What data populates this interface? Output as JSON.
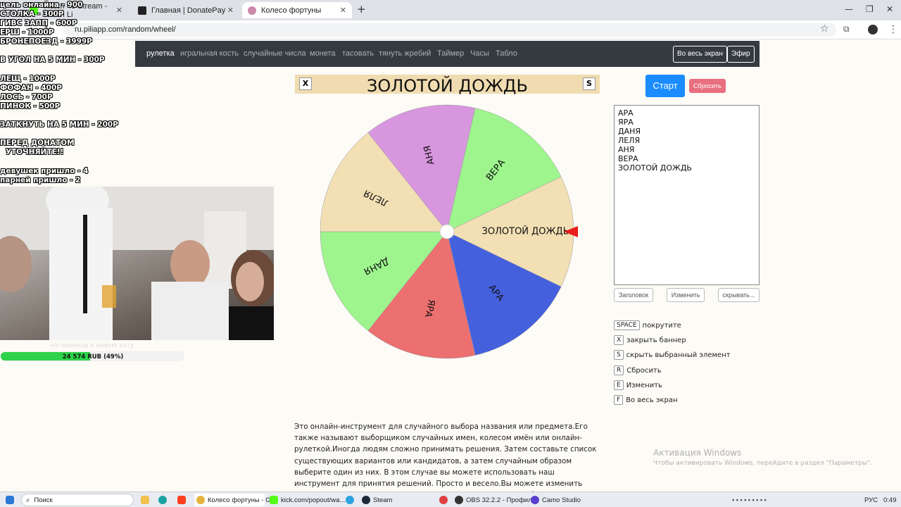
{
  "browser": {
    "tabs": [
      {
        "label": "Watch 43 Stream - Watch Li"
      },
      {
        "label": "Главная | DonatePay"
      },
      {
        "label": "Колесо фортуны"
      }
    ],
    "url": "ru.piliapp.com/random/wheel/"
  },
  "site_nav": {
    "items": [
      "рулетка",
      "игральная кость",
      "случайные числа",
      "монета",
      "тасовать",
      "тянуть жребий",
      "Таймер",
      "Часы",
      "Табло"
    ],
    "fullscreen_label": "Во весь экран",
    "live_label": "Эфир"
  },
  "banner": {
    "title": "ЗОЛОТОЙ ДОЖДЬ",
    "close_key": "X",
    "hide_key": "S"
  },
  "wheel": {
    "segments": [
      {
        "label": "ЗОЛОТОЙ ДОЖДЬ",
        "color": "#f2dfb4"
      },
      {
        "label": "АРА",
        "color": "#4560dd"
      },
      {
        "label": "ЯРА",
        "color": "#ec7070"
      },
      {
        "label": "ДАНЯ",
        "color": "#9ef58e"
      },
      {
        "label": "ЛЕЛЯ",
        "color": "#f2dfb4"
      },
      {
        "label": "АНЯ",
        "color": "#d896de"
      },
      {
        "label": "ВЕРА",
        "color": "#9ef58e"
      }
    ],
    "pointer_color": "#e81c1c"
  },
  "controls": {
    "start_label": "Старт",
    "reset_label": "Сбросить"
  },
  "names": [
    "АРА",
    "ЯРА",
    "ДАНЯ",
    "ЛЕЛЯ",
    "АНЯ",
    "ВЕРА",
    "ЗОЛОТОЙ ДОЖДЬ"
  ],
  "list_buttons": {
    "title_label": "Заголовок",
    "edit_label": "Изменить",
    "hide_label": "скрывать..."
  },
  "hotkeys": [
    {
      "key": "SPACE",
      "label": "покрутите"
    },
    {
      "key": "X",
      "label": "закрыть баннер"
    },
    {
      "key": "S",
      "label": "скрыть выбранный элемент"
    },
    {
      "key": "R",
      "label": "Сбросить"
    },
    {
      "key": "E",
      "label": "Изменить"
    },
    {
      "key": "F",
      "label": "Во весь экран"
    }
  ],
  "description": "Это онлайн-инструмент для случайного выбора названия или предмета.Его также называют выборщиком случайных имен, колесом имён или онлайн-рулеткой.Иногда людям сложно принимать решения. Затем составьте список существующих вариантов или кандидатов, а затем случайным образом выберите один из них. В этом случае вы можете использовать наш инструмент для принятия решений. Просто и весело.Вы можете изменить имена в текстовом поле, поместив одно имя в строку.Имена будут",
  "watermark": {
    "line1": "Активация Windows",
    "line2": "Чтобы активировать Windows, перейдите в раздел \"Параметры\"."
  },
  "overlay": {
    "lines": [
      "цель онлайна - 900",
      "СТОЛКА - 300Р",
      "ГИВС ЗАПП - 600Р",
      "ЕРШ - 1000Р",
      "БРОНЕПОЕЗД - 3999Р",
      "В УГОЛ НА 5 МИН - 300Р",
      "ЛЕЩ - 1000Р",
      "ФОФАН - 400Р",
      "ЛОСЬ - 700Р",
      "ПИНОК - 500Р",
      "ЗАТКНУТЬ НА 5 МИН - 200Р",
      "ПЕРЕД ДОНАТОМ",
      "УТОЧНЯЙТЕ!!",
      "девушек пришло - 4",
      "парней пришло - 2"
    ],
    "goal_caption": "на переезд в новую хату",
    "goal_label": "24 574 RUB (49%)",
    "goal_progress": 0.49
  },
  "taskbar": {
    "search_label": "Поиск",
    "apps": [
      "Колесо фортуны - G...",
      "kick.com/popout/wa...",
      "Steam",
      "OBS 32.2.2 - Профил...",
      "Camo Studio"
    ],
    "lang": "РУС",
    "time": "0:49"
  }
}
